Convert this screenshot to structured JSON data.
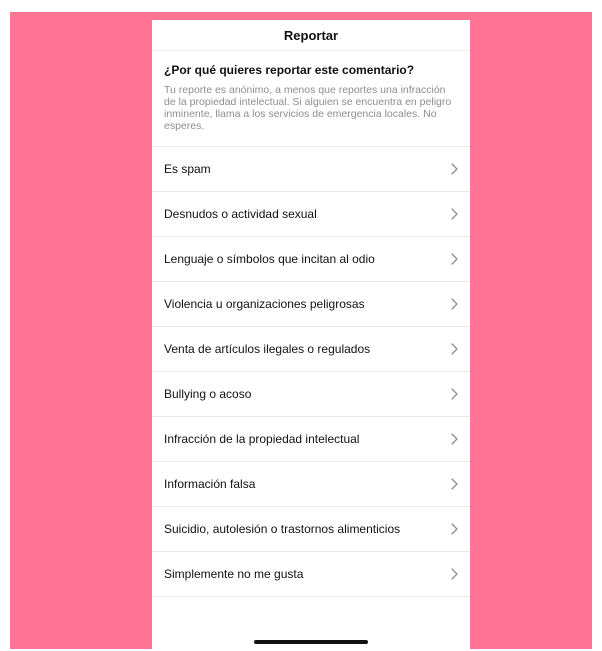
{
  "colors": {
    "background_pink": "#FF7395",
    "text_primary": "#111111",
    "text_secondary": "#8e8e8e",
    "divider": "#e8e8e8"
  },
  "header": {
    "title": "Reportar"
  },
  "intro": {
    "question": "¿Por qué quieres reportar este comentario?",
    "description": "Tu reporte es anónimo, a menos que reportes una infracción de la propiedad intelectual. Si alguien se encuentra en peligro inminente, llama a los servicios de emergencia locales. No esperes."
  },
  "options": [
    {
      "label": "Es spam",
      "icon": "chevron-right-icon"
    },
    {
      "label": "Desnudos o actividad sexual",
      "icon": "chevron-right-icon"
    },
    {
      "label": "Lenguaje o símbolos que incitan al odio",
      "icon": "chevron-right-icon"
    },
    {
      "label": "Violencia u organizaciones peligrosas",
      "icon": "chevron-right-icon"
    },
    {
      "label": "Venta de artículos ilegales o regulados",
      "icon": "chevron-right-icon"
    },
    {
      "label": "Bullying o acoso",
      "icon": "chevron-right-icon"
    },
    {
      "label": "Infracción de la propiedad intelectual",
      "icon": "chevron-right-icon"
    },
    {
      "label": "Información falsa",
      "icon": "chevron-right-icon"
    },
    {
      "label": "Suicidio, autolesión o trastornos alimenticios",
      "icon": "chevron-right-icon"
    },
    {
      "label": "Simplemente no me gusta",
      "icon": "chevron-right-icon"
    }
  ]
}
